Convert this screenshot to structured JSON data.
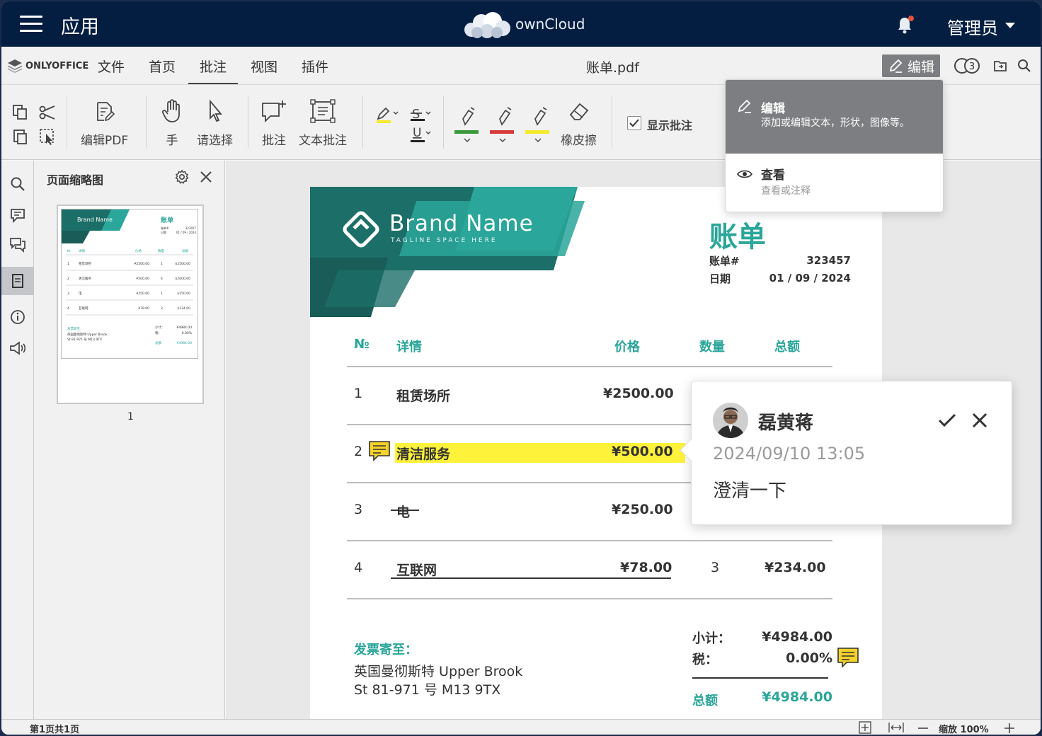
{
  "topbar": {
    "app_title": "应用",
    "brand": "ownCloud",
    "user": "管理员"
  },
  "menubar": {
    "logo": "ONLYOFFICE",
    "tabs": [
      "文件",
      "首页",
      "批注",
      "视图",
      "插件"
    ],
    "active_tab": "批注",
    "doc_name": "账单.pdf",
    "edit_label": "编辑",
    "co_users_count": "3"
  },
  "toolbar": {
    "edit_pdf": "编辑PDF",
    "hand": "手",
    "select": "请选择",
    "comment": "批注",
    "text_comment": "文本批注",
    "eraser": "橡皮擦",
    "show_comments": "显示批注",
    "pen_colors": [
      "#3a9a3a",
      "#d63a3a",
      "#f5ea2a"
    ],
    "highlight_color": "#f5ea2a"
  },
  "thumbnails": {
    "title": "页面缩略图",
    "page_number": "1"
  },
  "document": {
    "brand_name": "Brand Name",
    "tagline": "TAGLINE SPACE HERE",
    "title": "账单",
    "bill_no_label": "账单#",
    "bill_no": "323457",
    "date_label": "日期",
    "date": "01 / 09 / 2024",
    "headers": [
      "№",
      "详情",
      "价格",
      "数量",
      "总额"
    ],
    "rows": [
      {
        "no": "1",
        "item": "租赁场所",
        "price": "¥2500.00",
        "qty": "",
        "total": ""
      },
      {
        "no": "2",
        "item": "清洁服务",
        "price": "¥500.00",
        "qty": "",
        "total": ""
      },
      {
        "no": "3",
        "item": "电",
        "price": "¥250.00",
        "qty": "",
        "total": ""
      },
      {
        "no": "4",
        "item": "互联网",
        "price": "¥78.00",
        "qty": "3",
        "total": "¥234.00"
      }
    ],
    "ship_label": "发票寄至：",
    "ship_line1": "英国曼彻斯特 Upper Brook",
    "ship_line2": "St 81-971 号 M13 9TX",
    "subtotal_label": "小计：",
    "subtotal": "¥4984.00",
    "tax_label": "税：",
    "tax": "0.00%",
    "total_label": "总额",
    "total": "¥4984.00",
    "accent_color": "#2aa69a"
  },
  "thumb_preview": {
    "rows": [
      [
        "1",
        "租赁场所",
        "¥2500.00",
        "1",
        "$2500.00"
      ],
      [
        "2",
        "清洁服务",
        "¥500.00",
        "4",
        "$2000.00"
      ],
      [
        "3",
        "电",
        "¥250.00",
        "1",
        "$250.00"
      ],
      [
        "4",
        "互联网",
        "¥78.00",
        "3",
        "$234.00"
      ]
    ],
    "sub_label": "小计：",
    "sub_value": "¥4984.00",
    "tax_label": "税：",
    "tax_value": "0.00%",
    "total_label": "总额",
    "total_value": "¥4984.00",
    "ship_label": "发票寄至：",
    "ship_line1": "英国曼彻斯特 Upper Brook",
    "ship_line2": "St 81-971 号 M13 9TX"
  },
  "comment": {
    "author": "磊黄蒋",
    "date": "2024/09/10 13:05",
    "text": "澄清一下"
  },
  "edit_menu": {
    "edit_title": "编辑",
    "edit_desc": "添加或编辑文本，形状，图像等。",
    "view_title": "查看",
    "view_desc": "查看或注释"
  },
  "statusbar": {
    "page_info": "第1页共1页",
    "zoom": "缩放 100%"
  }
}
